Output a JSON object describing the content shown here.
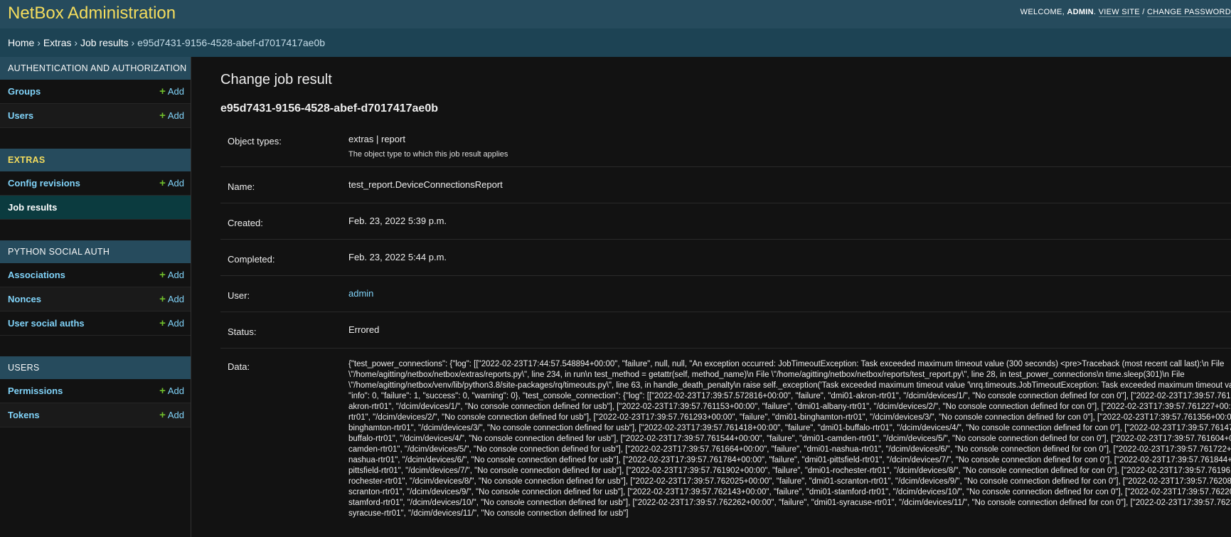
{
  "header": {
    "branding": "NetBox Administration",
    "welcome": "WELCOME, ",
    "username": "ADMIN",
    "view_site": "VIEW SITE",
    "separator": " / ",
    "change_password": "CHANGE PASSWORD"
  },
  "breadcrumbs": {
    "home": "Home",
    "app": "Extras",
    "model": "Job results",
    "current": "e95d7431-9156-4528-abef-d7017417ae0b",
    "sep": " › "
  },
  "sidebar": {
    "add_label": "Add",
    "modules": [
      {
        "caption": "Authentication and Authorization",
        "items": [
          "Groups",
          "Users"
        ]
      },
      {
        "caption": "Extras",
        "items": [
          "Config revisions",
          "Job results"
        ]
      },
      {
        "caption": "Python Social Auth",
        "items": [
          "Associations",
          "Nonces",
          "User social auths"
        ]
      },
      {
        "caption": "Users",
        "items": [
          "Permissions",
          "Tokens"
        ]
      }
    ]
  },
  "content": {
    "heading": "Change job result",
    "object_title": "e95d7431-9156-4528-abef-d7017417ae0b",
    "fields": {
      "object_types": {
        "label": "Object types:",
        "value": "extras | report",
        "help": "The object type to which this job result applies"
      },
      "name": {
        "label": "Name:",
        "value": "test_report.DeviceConnectionsReport"
      },
      "created": {
        "label": "Created:",
        "value": "Feb. 23, 2022 5:39 p.m."
      },
      "completed": {
        "label": "Completed:",
        "value": "Feb. 23, 2022 5:44 p.m."
      },
      "user": {
        "label": "User:",
        "value": "admin"
      },
      "status": {
        "label": "Status:",
        "value": "Errored"
      },
      "data": {
        "label": "Data:",
        "value": "{\"test_power_connections\": {\"log\": [[\"2022-02-23T17:44:57.548894+00:00\", \"failure\", null, null, \"An exception occurred: JobTimeoutException: Task exceeded maximum timeout value (300 seconds) <pre>Traceback (most recent call last):\\n File \\\"/home/agitting/netbox/netbox/extras/reports.py\\\", line 234, in run\\n test_method = getattr(self, method_name)\\n File \\\"/home/agitting/netbox/netbox/reports/test_report.py\\\", line 28, in test_power_connections\\n time.sleep(301)\\n File \\\"/home/agitting/netbox/venv/lib/python3.8/site-packages/rq/timeouts.py\\\", line 63, in handle_death_penalty\\n raise self._exception('Task exceeded maximum timeout value '\\nrq.timeouts.JobTimeoutException: Task exceeded maximum timeout value (300 seconds)\\n</pre>\"]], \"info\": 0, \"failure\": 1, \"success\": 0, \"warning\": 0}, \"test_console_connection\": {\"log\": [[\"2022-02-23T17:39:57.572816+00:00\", \"failure\", \"dmi01-akron-rtr01\", \"/dcim/devices/1/\", \"No console connection defined for con 0\"], [\"2022-02-23T17:39:57.761038+00:00\", \"failure\", \"dmi01-akron-rtr01\", \"/dcim/devices/1/\", \"No console connection defined for usb\"], [\"2022-02-23T17:39:57.761153+00:00\", \"failure\", \"dmi01-albany-rtr01\", \"/dcim/devices/2/\", \"No console connection defined for con 0\"], [\"2022-02-23T17:39:57.761227+00:00\", \"failure\", \"dmi01-albany-rtr01\", \"/dcim/devices/2/\", \"No console connection defined for usb\"], [\"2022-02-23T17:39:57.761293+00:00\", \"failure\", \"dmi01-binghamton-rtr01\", \"/dcim/devices/3/\", \"No console connection defined for con 0\"], [\"2022-02-23T17:39:57.761356+00:00\", \"failure\", \"dmi01-binghamton-rtr01\", \"/dcim/devices/3/\", \"No console connection defined for usb\"], [\"2022-02-23T17:39:57.761418+00:00\", \"failure\", \"dmi01-buffalo-rtr01\", \"/dcim/devices/4/\", \"No console connection defined for con 0\"], [\"2022-02-23T17:39:57.761479+00:00\", \"failure\", \"dmi01-buffalo-rtr01\", \"/dcim/devices/4/\", \"No console connection defined for usb\"], [\"2022-02-23T17:39:57.761544+00:00\", \"failure\", \"dmi01-camden-rtr01\", \"/dcim/devices/5/\", \"No console connection defined for con 0\"], [\"2022-02-23T17:39:57.761604+00:00\", \"failure\", \"dmi01-camden-rtr01\", \"/dcim/devices/5/\", \"No console connection defined for usb\"], [\"2022-02-23T17:39:57.761664+00:00\", \"failure\", \"dmi01-nashua-rtr01\", \"/dcim/devices/6/\", \"No console connection defined for con 0\"], [\"2022-02-23T17:39:57.761722+00:00\", \"failure\", \"dmi01-nashua-rtr01\", \"/dcim/devices/6/\", \"No console connection defined for usb\"], [\"2022-02-23T17:39:57.761784+00:00\", \"failure\", \"dmi01-pittsfield-rtr01\", \"/dcim/devices/7/\", \"No console connection defined for con 0\"], [\"2022-02-23T17:39:57.761844+00:00\", \"failure\", \"dmi01-pittsfield-rtr01\", \"/dcim/devices/7/\", \"No console connection defined for usb\"], [\"2022-02-23T17:39:57.761902+00:00\", \"failure\", \"dmi01-rochester-rtr01\", \"/dcim/devices/8/\", \"No console connection defined for con 0\"], [\"2022-02-23T17:39:57.761961+00:00\", \"failure\", \"dmi01-rochester-rtr01\", \"/dcim/devices/8/\", \"No console connection defined for usb\"], [\"2022-02-23T17:39:57.762025+00:00\", \"failure\", \"dmi01-scranton-rtr01\", \"/dcim/devices/9/\", \"No console connection defined for con 0\"], [\"2022-02-23T17:39:57.762084+00:00\", \"failure\", \"dmi01-scranton-rtr01\", \"/dcim/devices/9/\", \"No console connection defined for usb\"], [\"2022-02-23T17:39:57.762143+00:00\", \"failure\", \"dmi01-stamford-rtr01\", \"/dcim/devices/10/\", \"No console connection defined for con 0\"], [\"2022-02-23T17:39:57.762203+00:00\", \"failure\", \"dmi01-stamford-rtr01\", \"/dcim/devices/10/\", \"No console connection defined for usb\"], [\"2022-02-23T17:39:57.762262+00:00\", \"failure\", \"dmi01-syracuse-rtr01\", \"/dcim/devices/11/\", \"No console connection defined for con 0\"], [\"2022-02-23T17:39:57.762321+00:00\", \"failure\", \"dmi01-syracuse-rtr01\", \"/dcim/devices/11/\", \"No console connection defined for usb\"]"
      }
    }
  },
  "colors": {
    "header_bg": "#264b5d",
    "branding": "#f5dd5d",
    "link": "#81d4fa",
    "add_plus": "#70bf2b",
    "selected_row": "#0b3b3f",
    "page_bg": "#121212"
  }
}
